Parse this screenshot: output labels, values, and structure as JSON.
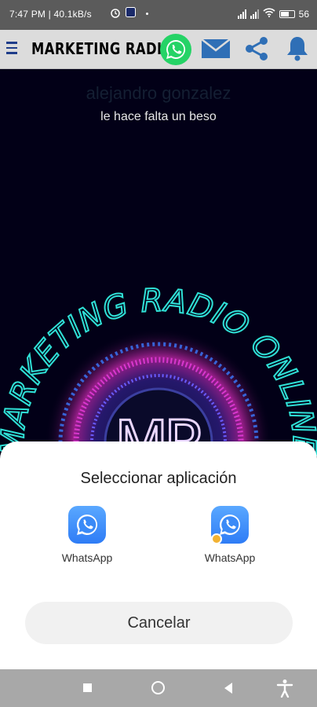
{
  "status_bar": {
    "time_speed": "7:47 PM | 40.1kB/s",
    "battery": "56"
  },
  "toolbar": {
    "title": "MARKETING RADIO",
    "icons": [
      "menu-icon",
      "whatsapp-icon",
      "mail-icon",
      "share-icon",
      "bell-icon"
    ]
  },
  "now_playing": {
    "artist": "alejandro gonzalez",
    "song": "le hace falta un beso"
  },
  "logo": {
    "monogram": "MR",
    "arc_text": "MARKETING RADIO ONLINE"
  },
  "chooser": {
    "title": "Seleccionar aplicación",
    "apps": [
      {
        "label": "WhatsApp",
        "icon": "whatsapp-icon"
      },
      {
        "label": "WhatsApp",
        "icon": "whatsapp-dual-icon"
      }
    ],
    "cancel_label": "Cancelar"
  },
  "colors": {
    "sheet_bg": "#ffffff",
    "app_icon_blue": "#3a8af7",
    "logo_cyan": "#2fe0d6",
    "logo_magenta": "#d02bd8"
  }
}
